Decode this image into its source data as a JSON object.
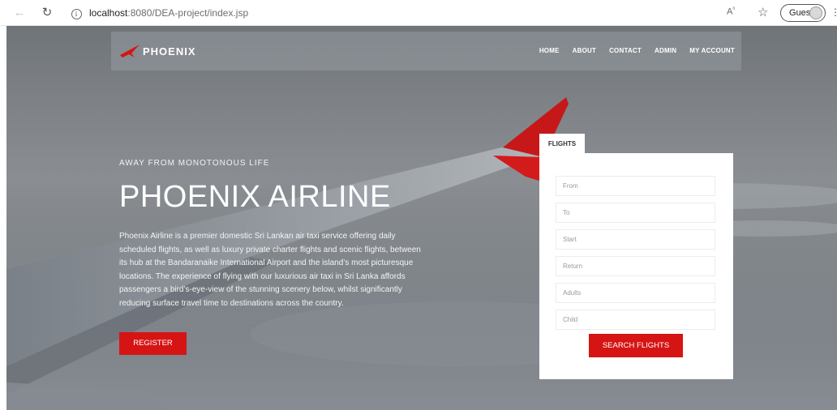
{
  "browser": {
    "url_host": "localhost",
    "url_path": ":8080/DEA-project/index.jsp",
    "guest_label": "Guest",
    "icons": [
      "back-icon",
      "reload-icon",
      "info-icon",
      "read-aloud-icon",
      "favorites-icon",
      "avatar-icon"
    ]
  },
  "nav": {
    "brand": "PHOENIX",
    "items": [
      "HOME",
      "ABOUT",
      "CONTACT",
      "ADMIN",
      "MY ACCOUNT"
    ]
  },
  "hero": {
    "tagline": "AWAY FROM MONOTONOUS LIFE",
    "title": "PHOENIX AIRLINE",
    "description": "Phoenix Airline is a premier domestic Sri Lankan air taxi service offering daily scheduled flights, as well as luxury private charter flights and scenic flights, between its hub at the Bandaranaike International Airport and the island’s most picturesque locations. The experience of flying with our luxurious air taxi in Sri Lanka affords passengers a bird’s-eye-view of the stunning scenery below, whilst significantly reducing surface travel time to destinations across the country.",
    "register_label": "REGISTER"
  },
  "flights": {
    "tab_label": "FLIGHTS",
    "fields": [
      "From",
      "To",
      "Start",
      "Return",
      "Adults",
      "Child"
    ],
    "search_label": "SEARCH FLIGHTS"
  },
  "colors": {
    "accent": "#d61414",
    "panel": "#ffffff"
  }
}
